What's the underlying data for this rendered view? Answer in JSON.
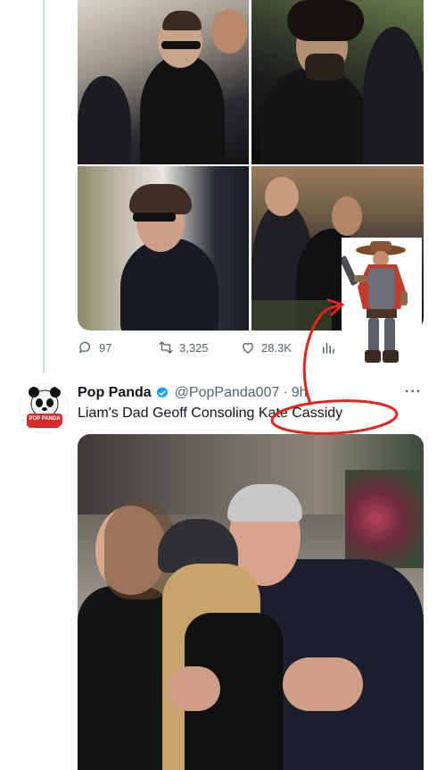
{
  "colors": {
    "accent_blue": "#1d9bf0",
    "annotation_red": "#e3231c",
    "secondary_text": "#536471",
    "primary_text": "#0f1419"
  },
  "prev_tweet": {
    "actions": {
      "reply_count": "97",
      "retweet_count": "3,325",
      "like_count": "28.3K"
    }
  },
  "tweet": {
    "display_name": "Pop Panda",
    "handle": "@PopPanda007",
    "time_sep": "·",
    "time": "9h",
    "text_prefix": "Liam's Dad Geoff Consoling ",
    "text_highlight": "Kate Cassidy",
    "more_label": "···",
    "avatar_text": "POP PANDA"
  },
  "icons": {
    "reply": "reply-bubble-icon",
    "retweet": "retweet-icon",
    "like": "heart-icon",
    "views": "bar-chart-icon",
    "verified": "verified-badge-icon",
    "more": "more-dots-icon"
  }
}
